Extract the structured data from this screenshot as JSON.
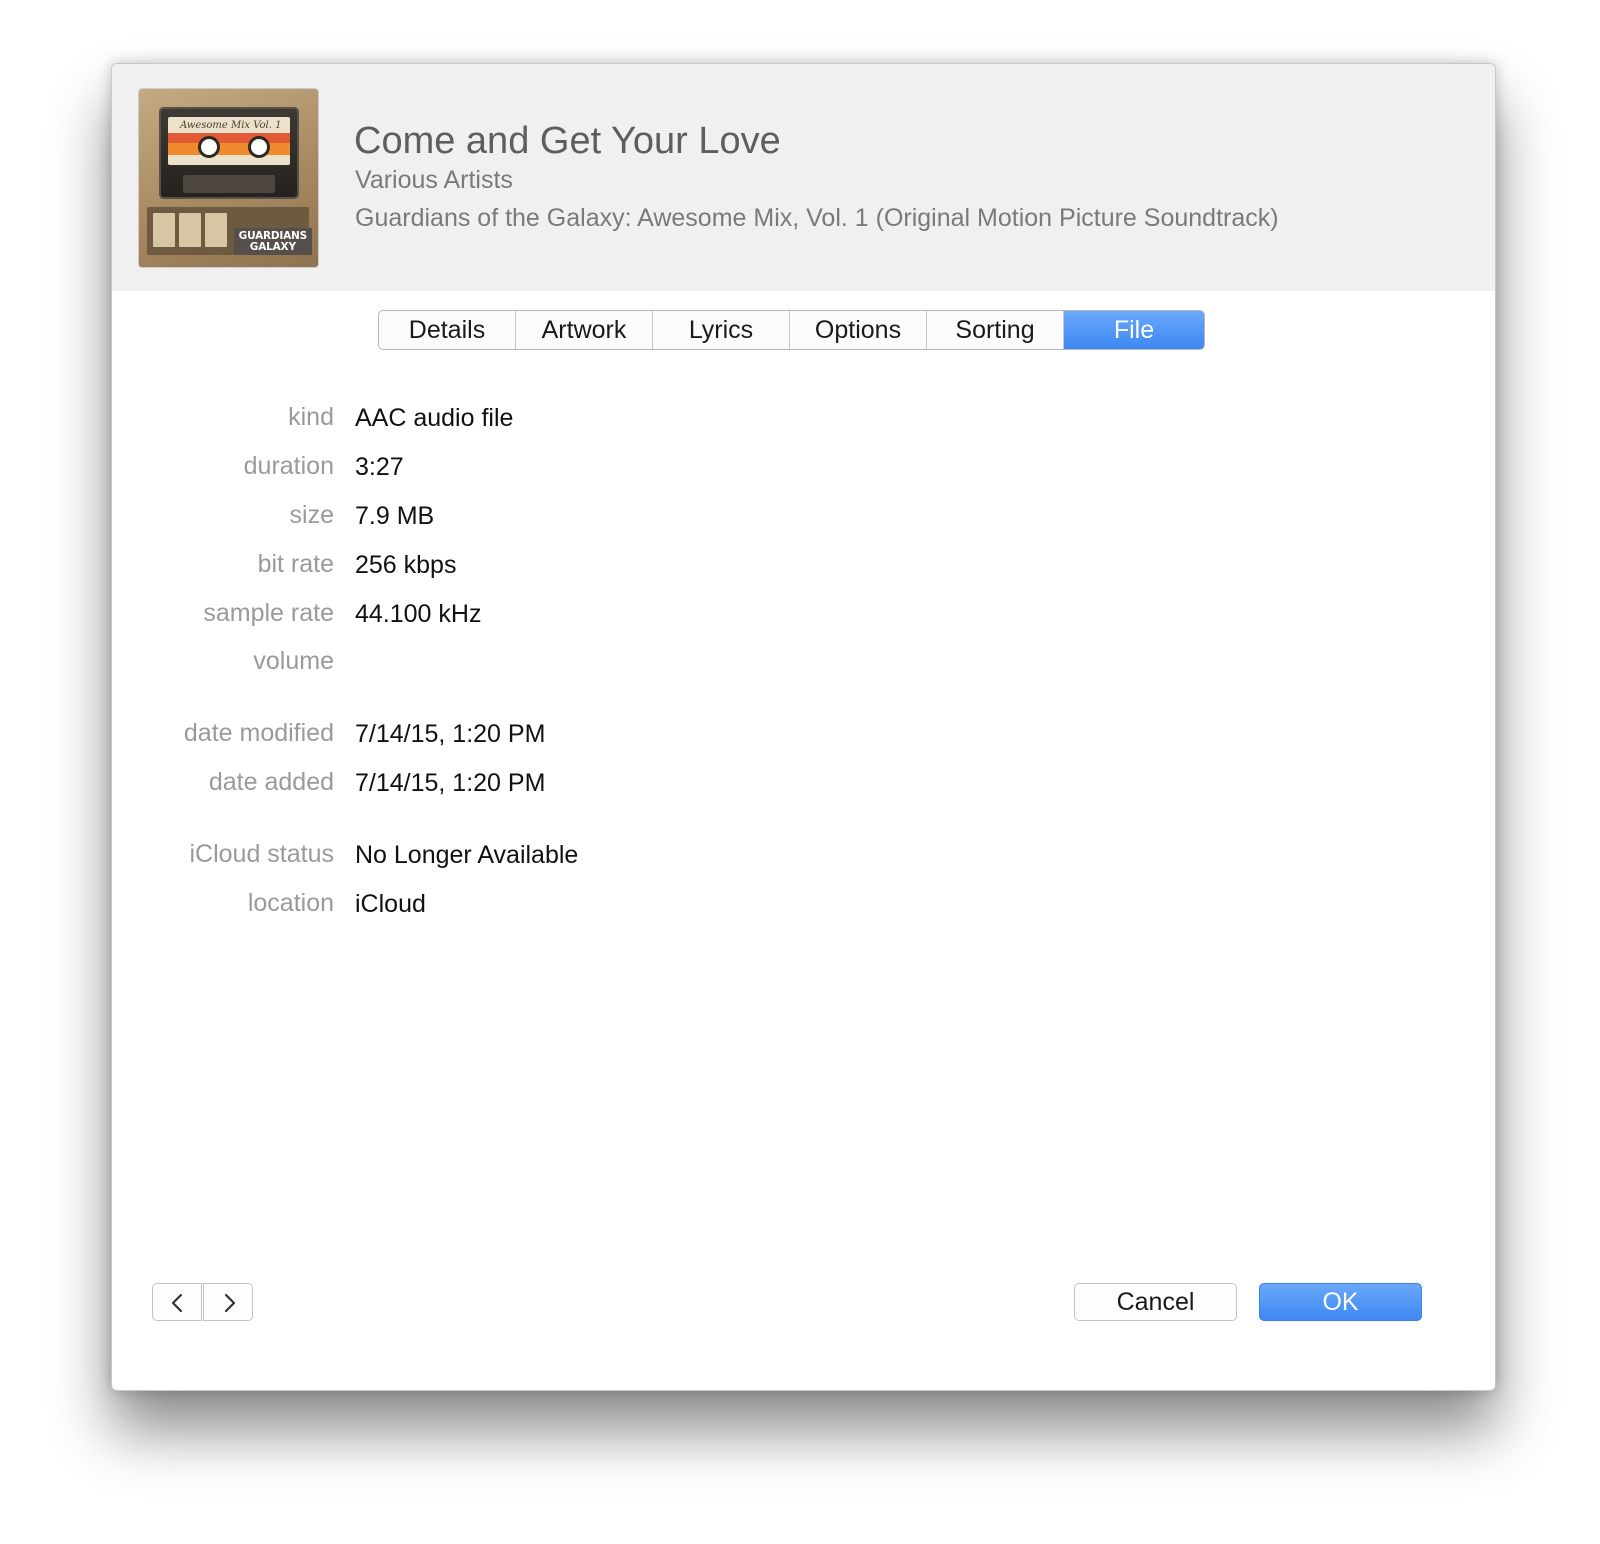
{
  "header": {
    "title": "Come and Get Your Love",
    "artist": "Various Artists",
    "album": "Guardians of the Galaxy: Awesome Mix, Vol. 1 (Original Motion Picture Soundtrack)",
    "artwork": {
      "cassette_label": "Awesome Mix Vol. 1",
      "logo_line1": "GUARDIANS",
      "logo_line2": "GALAXY"
    }
  },
  "tabs": [
    {
      "label": "Details",
      "selected": false
    },
    {
      "label": "Artwork",
      "selected": false
    },
    {
      "label": "Lyrics",
      "selected": false
    },
    {
      "label": "Options",
      "selected": false
    },
    {
      "label": "Sorting",
      "selected": false
    },
    {
      "label": "File",
      "selected": true
    }
  ],
  "file_info": {
    "kind": {
      "label": "kind",
      "value": "AAC audio file"
    },
    "duration": {
      "label": "duration",
      "value": "3:27"
    },
    "size": {
      "label": "size",
      "value": "7.9 MB"
    },
    "bit_rate": {
      "label": "bit rate",
      "value": "256 kbps"
    },
    "sample_rate": {
      "label": "sample rate",
      "value": "44.100 kHz"
    },
    "volume": {
      "label": "volume",
      "value": ""
    },
    "date_modified": {
      "label": "date modified",
      "value": "7/14/15, 1:20 PM"
    },
    "date_added": {
      "label": "date added",
      "value": "7/14/15, 1:20 PM"
    },
    "icloud_status": {
      "label": "iCloud status",
      "value": "No Longer Available"
    },
    "location": {
      "label": "location",
      "value": "iCloud"
    }
  },
  "footer": {
    "prev_icon": "chevron-left-icon",
    "next_icon": "chevron-right-icon",
    "cancel_label": "Cancel",
    "ok_label": "OK"
  },
  "colors": {
    "accent": "#3e87f3",
    "header_bg": "#f0f0f0",
    "label_gray": "#9a9a9a"
  }
}
